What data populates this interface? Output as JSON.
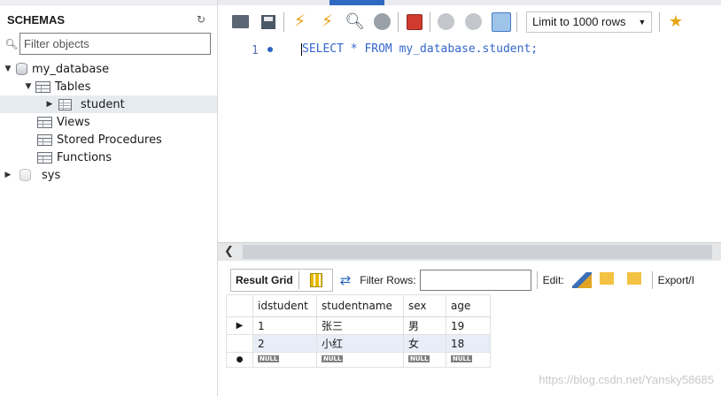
{
  "navigator": {
    "title": "SCHEMAS",
    "filter_placeholder": "Filter objects",
    "tree": [
      {
        "label": "my_database",
        "type": "schema",
        "expanded": true
      },
      {
        "label": "Tables",
        "type": "folder",
        "expanded": true
      },
      {
        "label": "student",
        "type": "table",
        "selected": true
      },
      {
        "label": "Views",
        "type": "folder"
      },
      {
        "label": "Stored Procedures",
        "type": "folder"
      },
      {
        "label": "Functions",
        "type": "folder"
      },
      {
        "label": "sys",
        "type": "schema",
        "expanded": false
      }
    ]
  },
  "toolbar": {
    "limit_label": "Limit to 1000 rows",
    "icons": [
      "open-folder-icon",
      "save-icon",
      "execute-lightning-icon",
      "execute-current-lightning-icon",
      "explain-magnifier-icon",
      "stop-icon",
      "toggle-error-icon",
      "commit-icon",
      "rollback-icon",
      "autocommit-icon",
      "bookmark-star-icon"
    ]
  },
  "editor": {
    "line_number": "1",
    "query_first": "S",
    "query_rest": "ELECT * FROM my_database.student;"
  },
  "results": {
    "result_grid_label": "Result Grid",
    "filter_rows_label": "Filter Rows:",
    "edit_label": "Edit:",
    "export_label": "Export/I",
    "columns": [
      "idstudent",
      "studentname",
      "sex",
      "age"
    ],
    "rows": [
      [
        "1",
        "张三",
        "男",
        "19"
      ],
      [
        "2",
        "小红",
        "女",
        "18"
      ]
    ],
    "null_label": "NULL"
  },
  "watermark": "https://blog.csdn.net/Yansky58685",
  "colors": {
    "accent": "#2f6ac0",
    "keyword": "#3366cc",
    "selected_row": "#e8eef8"
  }
}
